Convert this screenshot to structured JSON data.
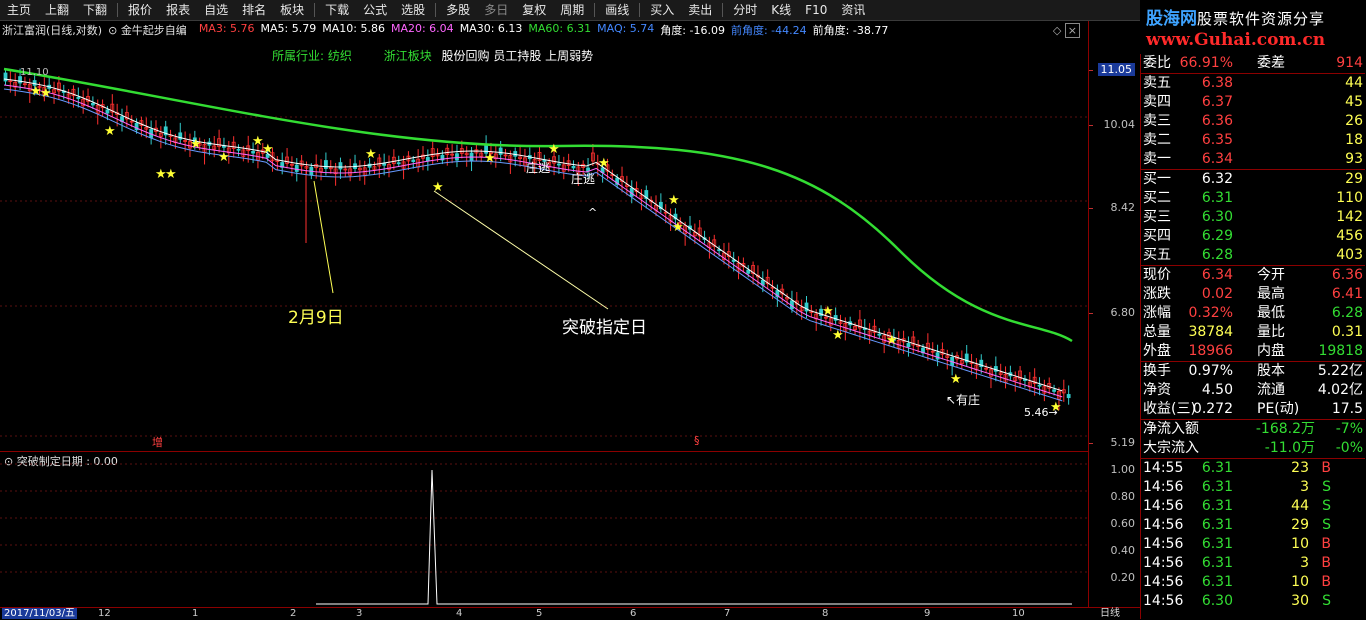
{
  "menu": [
    "主页",
    "上翻",
    "下翻",
    "|",
    "报价",
    "报表",
    "自选",
    "排名",
    "板块",
    "|",
    "下载",
    "公式",
    "选股",
    "|",
    "多股",
    "多日",
    "复权",
    "周期",
    "|",
    "画线",
    "|",
    "买入",
    "卖出",
    "|",
    "分时",
    "K线",
    "F10",
    "资讯"
  ],
  "logo": {
    "line1_a": "股海网",
    "line1_b": "股票软件资源分享",
    "line2": "www.Guhai.com.cn"
  },
  "chart": {
    "title": "浙江富润(日线,对数)",
    "formula": "金牛起步自编",
    "ma": [
      {
        "label": "MA3: 5.76",
        "color": "#ff4040"
      },
      {
        "label": "MA5: 5.79",
        "color": "#ffffff"
      },
      {
        "label": "MA10: 5.86",
        "color": "#ffffff"
      },
      {
        "label": "MA20: 6.04",
        "color": "#ff66ff"
      },
      {
        "label": "MA30: 6.13",
        "color": "#ffffff"
      },
      {
        "label": "MA60: 6.31",
        "color": "#33dd33"
      },
      {
        "label": "MAQ: 5.74",
        "color": "#4488ff"
      },
      {
        "label": "角度: -16.09",
        "color": "#ffffff"
      },
      {
        "label": "前角度: -44.24",
        "color": "#4488ff"
      },
      {
        "label": "前角度: -38.77",
        "color": "#ffffff"
      }
    ],
    "industry_label": "所属行业: 纺织",
    "sector_label": "浙江板块",
    "concepts": "股份回购 员工持股 上周弱势",
    "top_left_price": "11.10",
    "annotations": {
      "feb9": "2月9日",
      "breakout": "突破指定日",
      "zhuang1": "庄逃",
      "zhuang2": "庄逃",
      "youzhuang": "↖有庄",
      "low_price": "5.46→",
      "zeng": "增",
      "caret": "^"
    },
    "axis_labels": [
      "11.05",
      "10.04",
      "8.42",
      "6.80",
      "5.19"
    ]
  },
  "indicator": {
    "title": "突破制定日期 : 0.00",
    "axis_labels": [
      "1.00",
      "0.80",
      "0.60",
      "0.40",
      "0.20"
    ]
  },
  "bottom": {
    "date": "2017/11/03/五",
    "months": [
      "12",
      "1",
      "2",
      "3",
      "4",
      "5",
      "6",
      "7",
      "8",
      "9",
      "10"
    ],
    "period": "日线"
  },
  "quote": {
    "weibi": {
      "label": "委比",
      "value": "66.91%",
      "label2": "委差",
      "value2": "914"
    },
    "asks": [
      {
        "label": "卖五",
        "price": "6.38",
        "vol": "44"
      },
      {
        "label": "卖四",
        "price": "6.37",
        "vol": "45"
      },
      {
        "label": "卖三",
        "price": "6.36",
        "vol": "26"
      },
      {
        "label": "卖二",
        "price": "6.35",
        "vol": "18"
      },
      {
        "label": "卖一",
        "price": "6.34",
        "vol": "93"
      }
    ],
    "bids": [
      {
        "label": "买一",
        "price": "6.32",
        "vol": "29"
      },
      {
        "label": "买二",
        "price": "6.31",
        "vol": "110"
      },
      {
        "label": "买三",
        "price": "6.30",
        "vol": "142"
      },
      {
        "label": "买四",
        "price": "6.29",
        "vol": "456"
      },
      {
        "label": "买五",
        "price": "6.28",
        "vol": "403"
      }
    ],
    "stats": [
      {
        "l1": "现价",
        "v1": "6.34",
        "c1": "r",
        "l2": "今开",
        "v2": "6.36",
        "c2": "r"
      },
      {
        "l1": "涨跌",
        "v1": "0.02",
        "c1": "r",
        "l2": "最高",
        "v2": "6.41",
        "c2": "r"
      },
      {
        "l1": "涨幅",
        "v1": "0.32%",
        "c1": "r",
        "l2": "最低",
        "v2": "6.28",
        "c2": "g"
      },
      {
        "l1": "总量",
        "v1": "38784",
        "c1": "y",
        "l2": "量比",
        "v2": "0.31",
        "c2": "y"
      },
      {
        "l1": "外盘",
        "v1": "18966",
        "c1": "r",
        "l2": "内盘",
        "v2": "19818",
        "c2": "g"
      }
    ],
    "stats2": [
      {
        "l1": "换手",
        "v1": "0.97%",
        "l2": "股本",
        "v2": "5.22亿"
      },
      {
        "l1": "净资",
        "v1": "4.50",
        "l2": "流通",
        "v2": "4.02亿"
      },
      {
        "l1": "收益(三)",
        "v1": "0.272",
        "l2": "PE(动)",
        "v2": "17.5"
      }
    ],
    "flows": [
      {
        "label": "净流入额",
        "value": "-168.2万",
        "pct": "-7%"
      },
      {
        "label": "大宗流入",
        "value": "-11.0万",
        "pct": "-0%"
      }
    ],
    "ticks": [
      {
        "time": "14:55",
        "price": "6.31",
        "vol": "23",
        "bs": "B"
      },
      {
        "time": "14:56",
        "price": "6.31",
        "vol": "3",
        "bs": "S"
      },
      {
        "time": "14:56",
        "price": "6.31",
        "vol": "44",
        "bs": "S"
      },
      {
        "time": "14:56",
        "price": "6.31",
        "vol": "29",
        "bs": "S"
      },
      {
        "time": "14:56",
        "price": "6.31",
        "vol": "10",
        "bs": "B"
      },
      {
        "time": "14:56",
        "price": "6.31",
        "vol": "3",
        "bs": "B"
      },
      {
        "time": "14:56",
        "price": "6.31",
        "vol": "10",
        "bs": "B"
      },
      {
        "time": "14:56",
        "price": "6.30",
        "vol": "30",
        "bs": "S"
      }
    ]
  }
}
